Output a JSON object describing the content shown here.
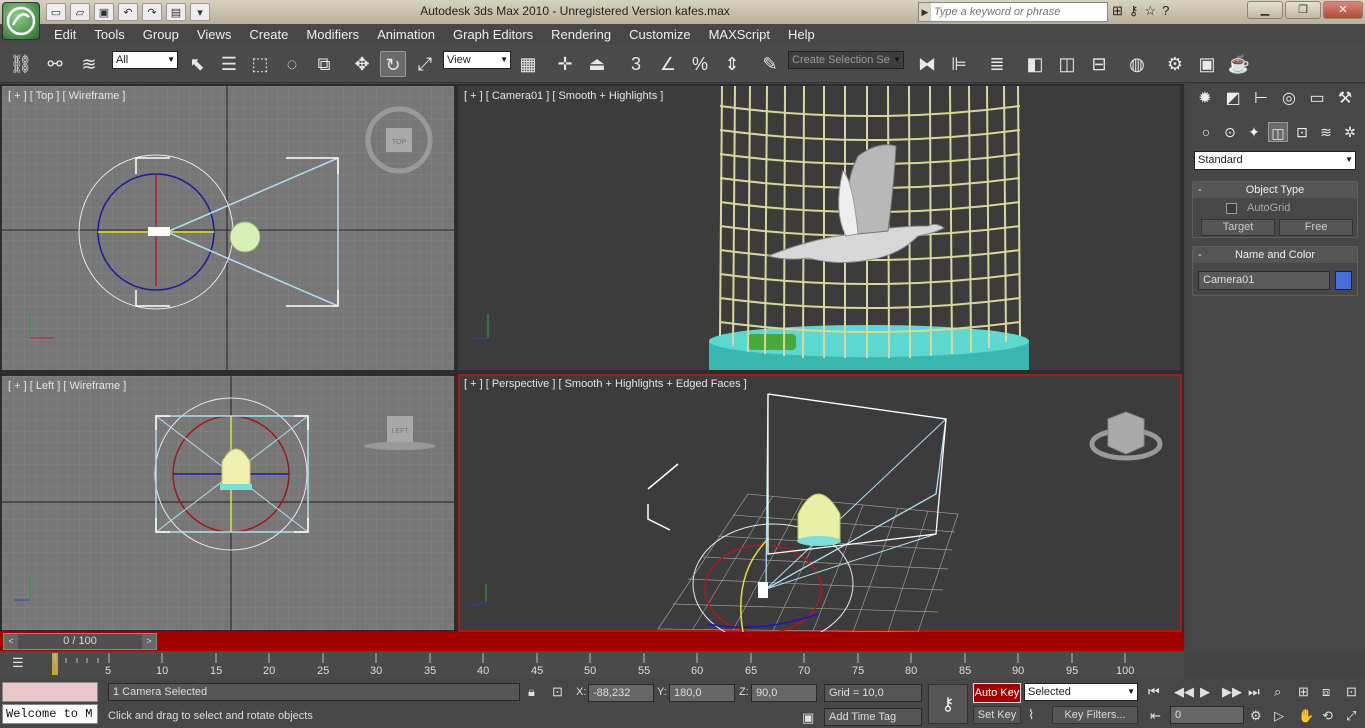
{
  "app": {
    "title": "Autodesk 3ds Max  2010   -  Unregistered Version     kafes.max",
    "logo": "app-logo"
  },
  "search": {
    "placeholder": "Type a keyword or phrase"
  },
  "menu": [
    "Edit",
    "Tools",
    "Group",
    "Views",
    "Create",
    "Modifiers",
    "Animation",
    "Graph Editors",
    "Rendering",
    "Customize",
    "MAXScript",
    "Help"
  ],
  "toolbar": {
    "filter_value": "All",
    "refcoord_value": "View",
    "selection_set_placeholder": "Create Selection Se"
  },
  "viewports": {
    "top": {
      "label": "[ + ] [ Top ] [ Wireframe ]",
      "cube_label": "TOP"
    },
    "camera": {
      "label": "[ + ] [ Camera01 ] [ Smooth + Highlights ]"
    },
    "left": {
      "label": "[ + ] [ Left ] [ Wireframe ]",
      "cube_label": "LEFT"
    },
    "perspective": {
      "label": "[ + ] [ Perspective ] [ Smooth + Highlights + Edged Faces ]"
    }
  },
  "command_panel": {
    "category_value": "Standard",
    "object_type": {
      "header": "Object Type",
      "autogrid": "AutoGrid",
      "buttons": [
        "Target",
        "Free"
      ]
    },
    "name_color": {
      "header": "Name and Color",
      "name_value": "Camera01",
      "color": "#4a6ed8"
    }
  },
  "time": {
    "slider_label": "0 / 100",
    "ruler": [
      "5",
      "10",
      "15",
      "20",
      "25",
      "30",
      "35",
      "40",
      "45",
      "50",
      "55",
      "60",
      "65",
      "70",
      "75",
      "80",
      "85",
      "90",
      "95",
      "100"
    ]
  },
  "status": {
    "maxscript_listener": "Welcome to M",
    "selection_info": "1 Camera Selected",
    "prompt": "Click and drag to select and rotate objects",
    "x_label": "X:",
    "x_value": "-88,232",
    "y_label": "Y:",
    "y_value": "180,0",
    "z_label": "Z:",
    "z_value": "90,0",
    "grid": "Grid = 10,0",
    "add_time_tag": "Add Time Tag",
    "auto_key": "Auto Key",
    "set_key": "Set Key",
    "key_mode_value": "Selected",
    "key_filters": "Key Filters...",
    "frame_value": "0"
  },
  "colors": {
    "accent_red": "#a00000",
    "cage": "#d8d89a",
    "base": "#3ab8b0"
  }
}
